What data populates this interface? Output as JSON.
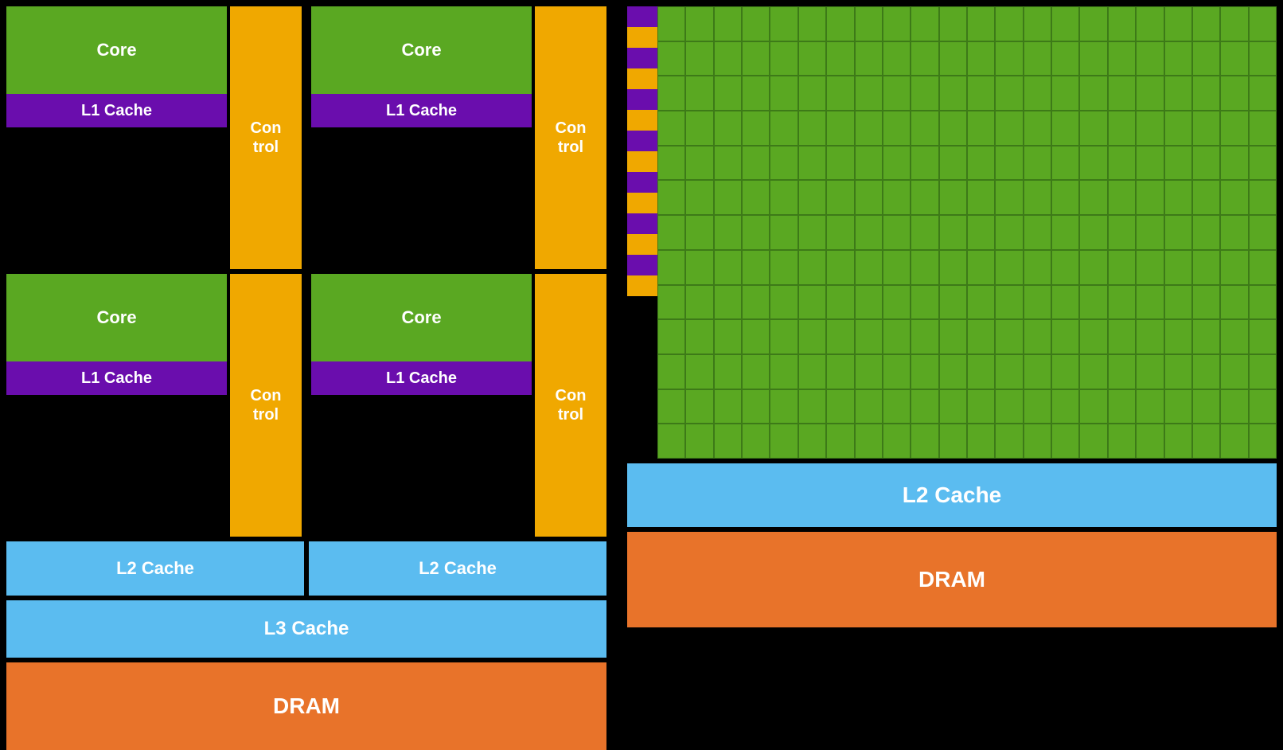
{
  "left": {
    "core1_label": "Core",
    "core2_label": "Core",
    "core3_label": "Core",
    "core4_label": "Core",
    "control1_label": "Con\ntrol",
    "control2_label": "Con\ntrol",
    "control3_label": "Con\ntrol",
    "control4_label": "Con\ntrol",
    "l1_cache1_label": "L1 Cache",
    "l1_cache2_label": "L1 Cache",
    "l1_cache3_label": "L1 Cache",
    "l1_cache4_label": "L1 Cache",
    "l2_cache1_label": "L2 Cache",
    "l2_cache2_label": "L2 Cache",
    "l3_cache_label": "L3 Cache",
    "dram_label": "DRAM"
  },
  "right": {
    "l2_cache_label": "L2 Cache",
    "dram_label": "DRAM",
    "grid_cols": 22,
    "grid_rows": 13,
    "stripe_count": 14
  }
}
